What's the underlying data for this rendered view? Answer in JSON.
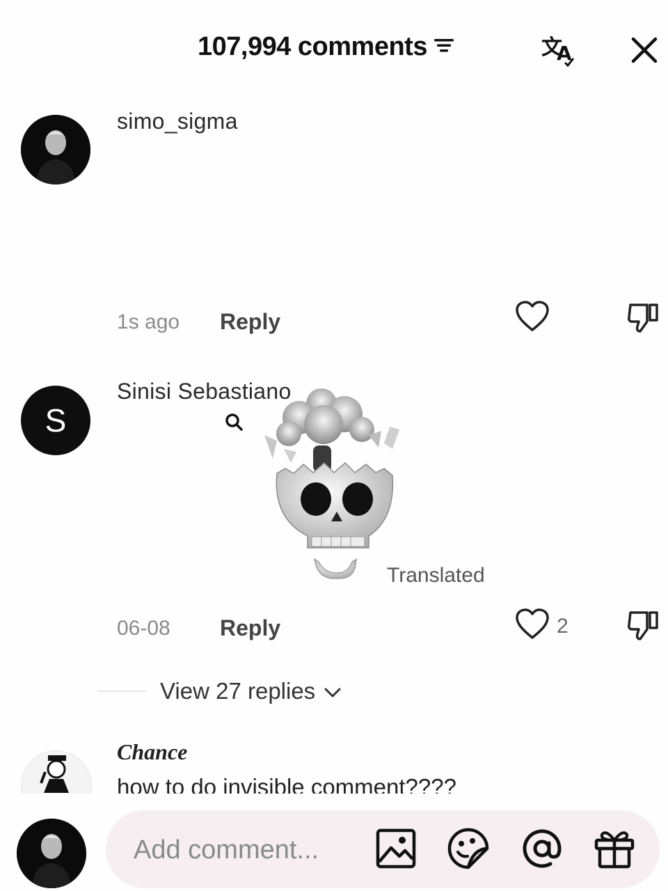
{
  "header": {
    "title": "107,994 comments",
    "icons": [
      "filter-icon",
      "translate-icon",
      "close-icon"
    ]
  },
  "comments": [
    {
      "username": "simo_sigma",
      "time": "1s ago",
      "reply_label": "Reply",
      "likes": ""
    },
    {
      "username": "Sinisi Sebastiano",
      "avatar_letter": "S",
      "sticker": "exploding-head-skull-sticker",
      "translated_label": "Translated",
      "time": "06-08",
      "reply_label": "Reply",
      "likes": "2",
      "view_replies": "View 27 replies"
    },
    {
      "username": "Chance",
      "text": "how to do invisible comment????"
    }
  ],
  "composer": {
    "placeholder": "Add comment...",
    "icons": [
      "image-icon",
      "sticker-icon",
      "mention-icon",
      "gift-icon"
    ]
  },
  "colors": {
    "pill_bg": "#f6eef1",
    "text": "#161616",
    "muted": "#8a8a8a"
  }
}
